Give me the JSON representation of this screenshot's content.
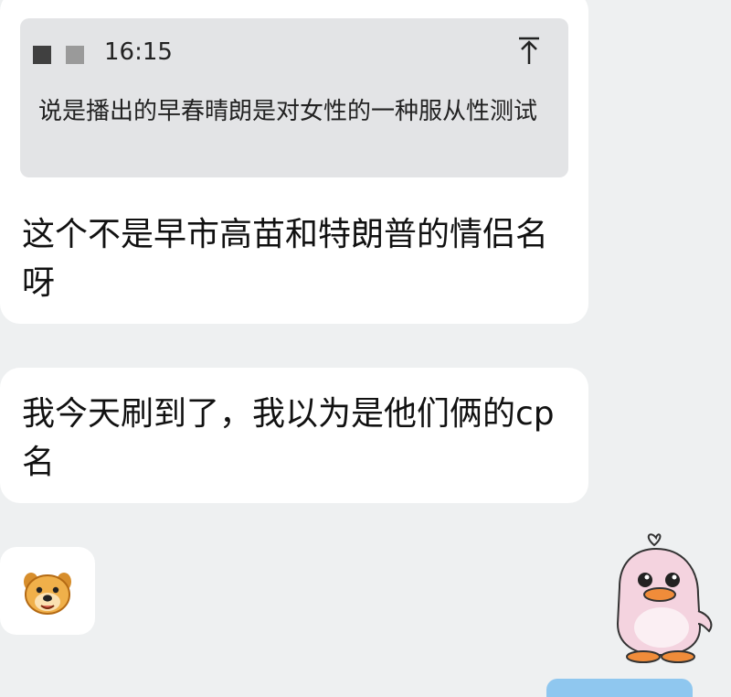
{
  "quoted": {
    "time": "16:15",
    "text": "说是播出的早春晴朗是对女性的一种服从性测试"
  },
  "messages": [
    {
      "text": "这个不是早市高苗和特朗普的情侣名呀"
    },
    {
      "text": "我今天刷到了，我以为是他们俩的cp名"
    }
  ],
  "stickers": {
    "small": "bear-sticker",
    "large": "duck-sticker"
  }
}
